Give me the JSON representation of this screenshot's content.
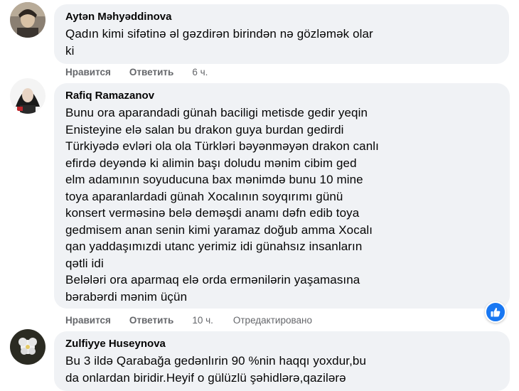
{
  "comments": [
    {
      "author": "Aytən Məhyəddinova",
      "text": "Qadın kimi sifətinə əl gəzdirən birindən nə gözləmək olar\nki",
      "like_label": "Нравится",
      "reply_label": "Ответить",
      "time": "6 ч."
    },
    {
      "author": "Rafiq Ramazanov",
      "text": "Bunu ora aparandadi günah baciligi metisde gedir yeqin\nEnisteyine elə salan bu drakon guya burdan gedirdi\nTürkiyədə evləri ola ola Türkləri bəyənməyən drakon canlı\nefirdə deyəndə ki alimin başı doludu mənim cibim ged\nelm adamının soyuducuna bax mənimdə bunu 10 mine\ntoya aparanlardadi günah Xocalının soyqırımı günü\nkonsert verməsinə belə deməşdi anamı dəfn edib toya\ngedmisem anan senin kimi yaramaz doğub amma Xocalı\nqan yaddaşımızdi utanc yerimiz idi günahsız insanların\nqətli idi\nBelələri ora aparmaq elə orda ermənilərin yaşamasına\nbərabərdi mənim üçün",
      "like_label": "Нравится",
      "reply_label": "Ответить",
      "time": "10 ч.",
      "edited": "Отредактировано"
    },
    {
      "author": "Zulfiyye Huseynova",
      "text": "Bu 3 ildə Qarabağa gedənlırin 90 %nin haqqı yoxdur,bu\nda onlardan biridir.Heyif o gülüzlü şəhidlərə,qazilərə"
    }
  ],
  "colors": {
    "bubble": "#f0f2f5",
    "meta": "#65676b",
    "like_blue": "#1877f2"
  },
  "icons": {
    "reaction": "thumbs-up-icon"
  }
}
